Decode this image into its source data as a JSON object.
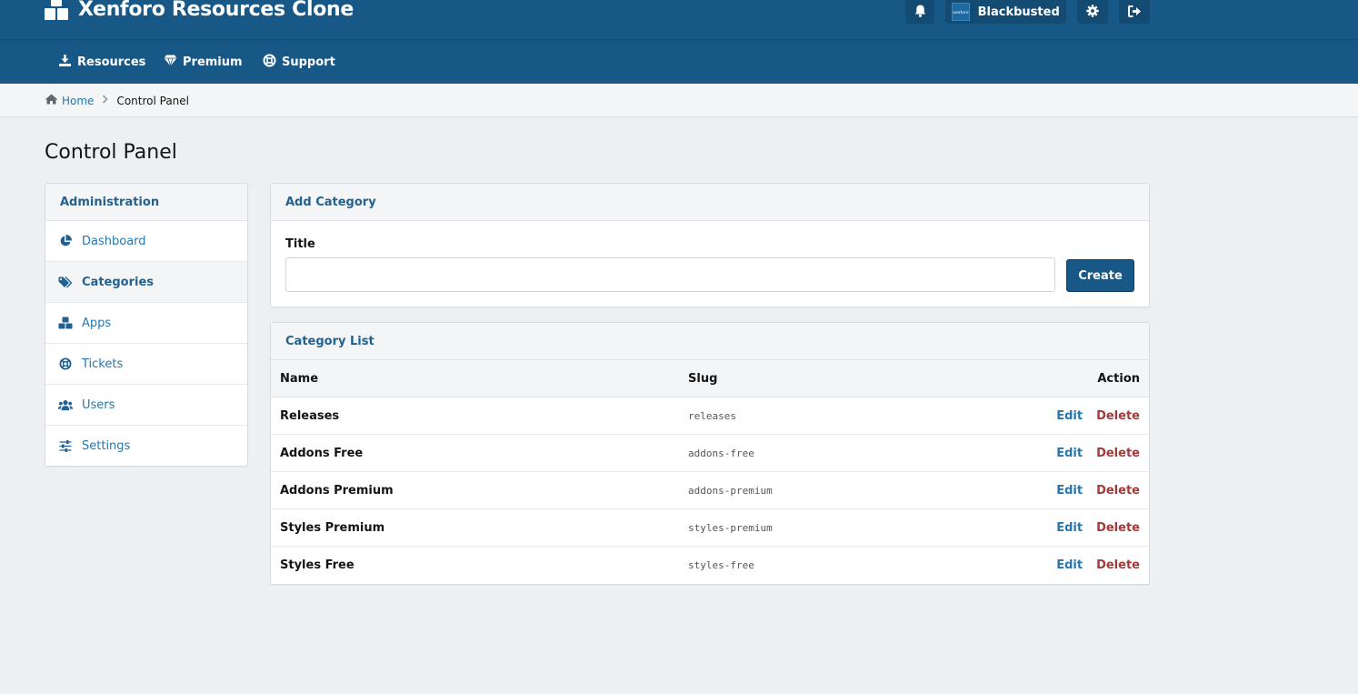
{
  "header": {
    "logo_text": "Xenforo Resources Clone",
    "avatar_text": "xenforo",
    "username": "Blackbusted"
  },
  "nav": {
    "items": [
      {
        "label": "Resources",
        "icon": "download-icon"
      },
      {
        "label": "Premium",
        "icon": "gem-icon"
      },
      {
        "label": "Support",
        "icon": "lifebuoy-icon"
      }
    ]
  },
  "breadcrumb": {
    "home": "Home",
    "current": "Control Panel"
  },
  "page": {
    "title": "Control Panel"
  },
  "sidebar": {
    "header": "Administration",
    "items": [
      {
        "label": "Dashboard",
        "icon": "pie-chart-icon",
        "active": false
      },
      {
        "label": "Categories",
        "icon": "tags-icon",
        "active": true
      },
      {
        "label": "Apps",
        "icon": "cubes-icon",
        "active": false
      },
      {
        "label": "Tickets",
        "icon": "lifebuoy-icon",
        "active": false
      },
      {
        "label": "Users",
        "icon": "users-icon",
        "active": false
      },
      {
        "label": "Settings",
        "icon": "sliders-icon",
        "active": false
      }
    ]
  },
  "add_category": {
    "header": "Add Category",
    "title_label": "Title",
    "title_value": "",
    "create_label": "Create"
  },
  "category_list": {
    "header": "Category List",
    "columns": {
      "name": "Name",
      "slug": "Slug",
      "action": "Action"
    },
    "edit_label": "Edit",
    "delete_label": "Delete",
    "rows": [
      {
        "name": "Releases",
        "slug": "releases"
      },
      {
        "name": "Addons Free",
        "slug": "addons-free"
      },
      {
        "name": "Addons Premium",
        "slug": "addons-premium"
      },
      {
        "name": "Styles Premium",
        "slug": "styles-premium"
      },
      {
        "name": "Styles Free",
        "slug": "styles-free"
      }
    ]
  },
  "colors": {
    "header_bg": "#185886",
    "link": "#2577b1",
    "danger": "#a33a3a",
    "page_bg": "#ecf0f3"
  }
}
